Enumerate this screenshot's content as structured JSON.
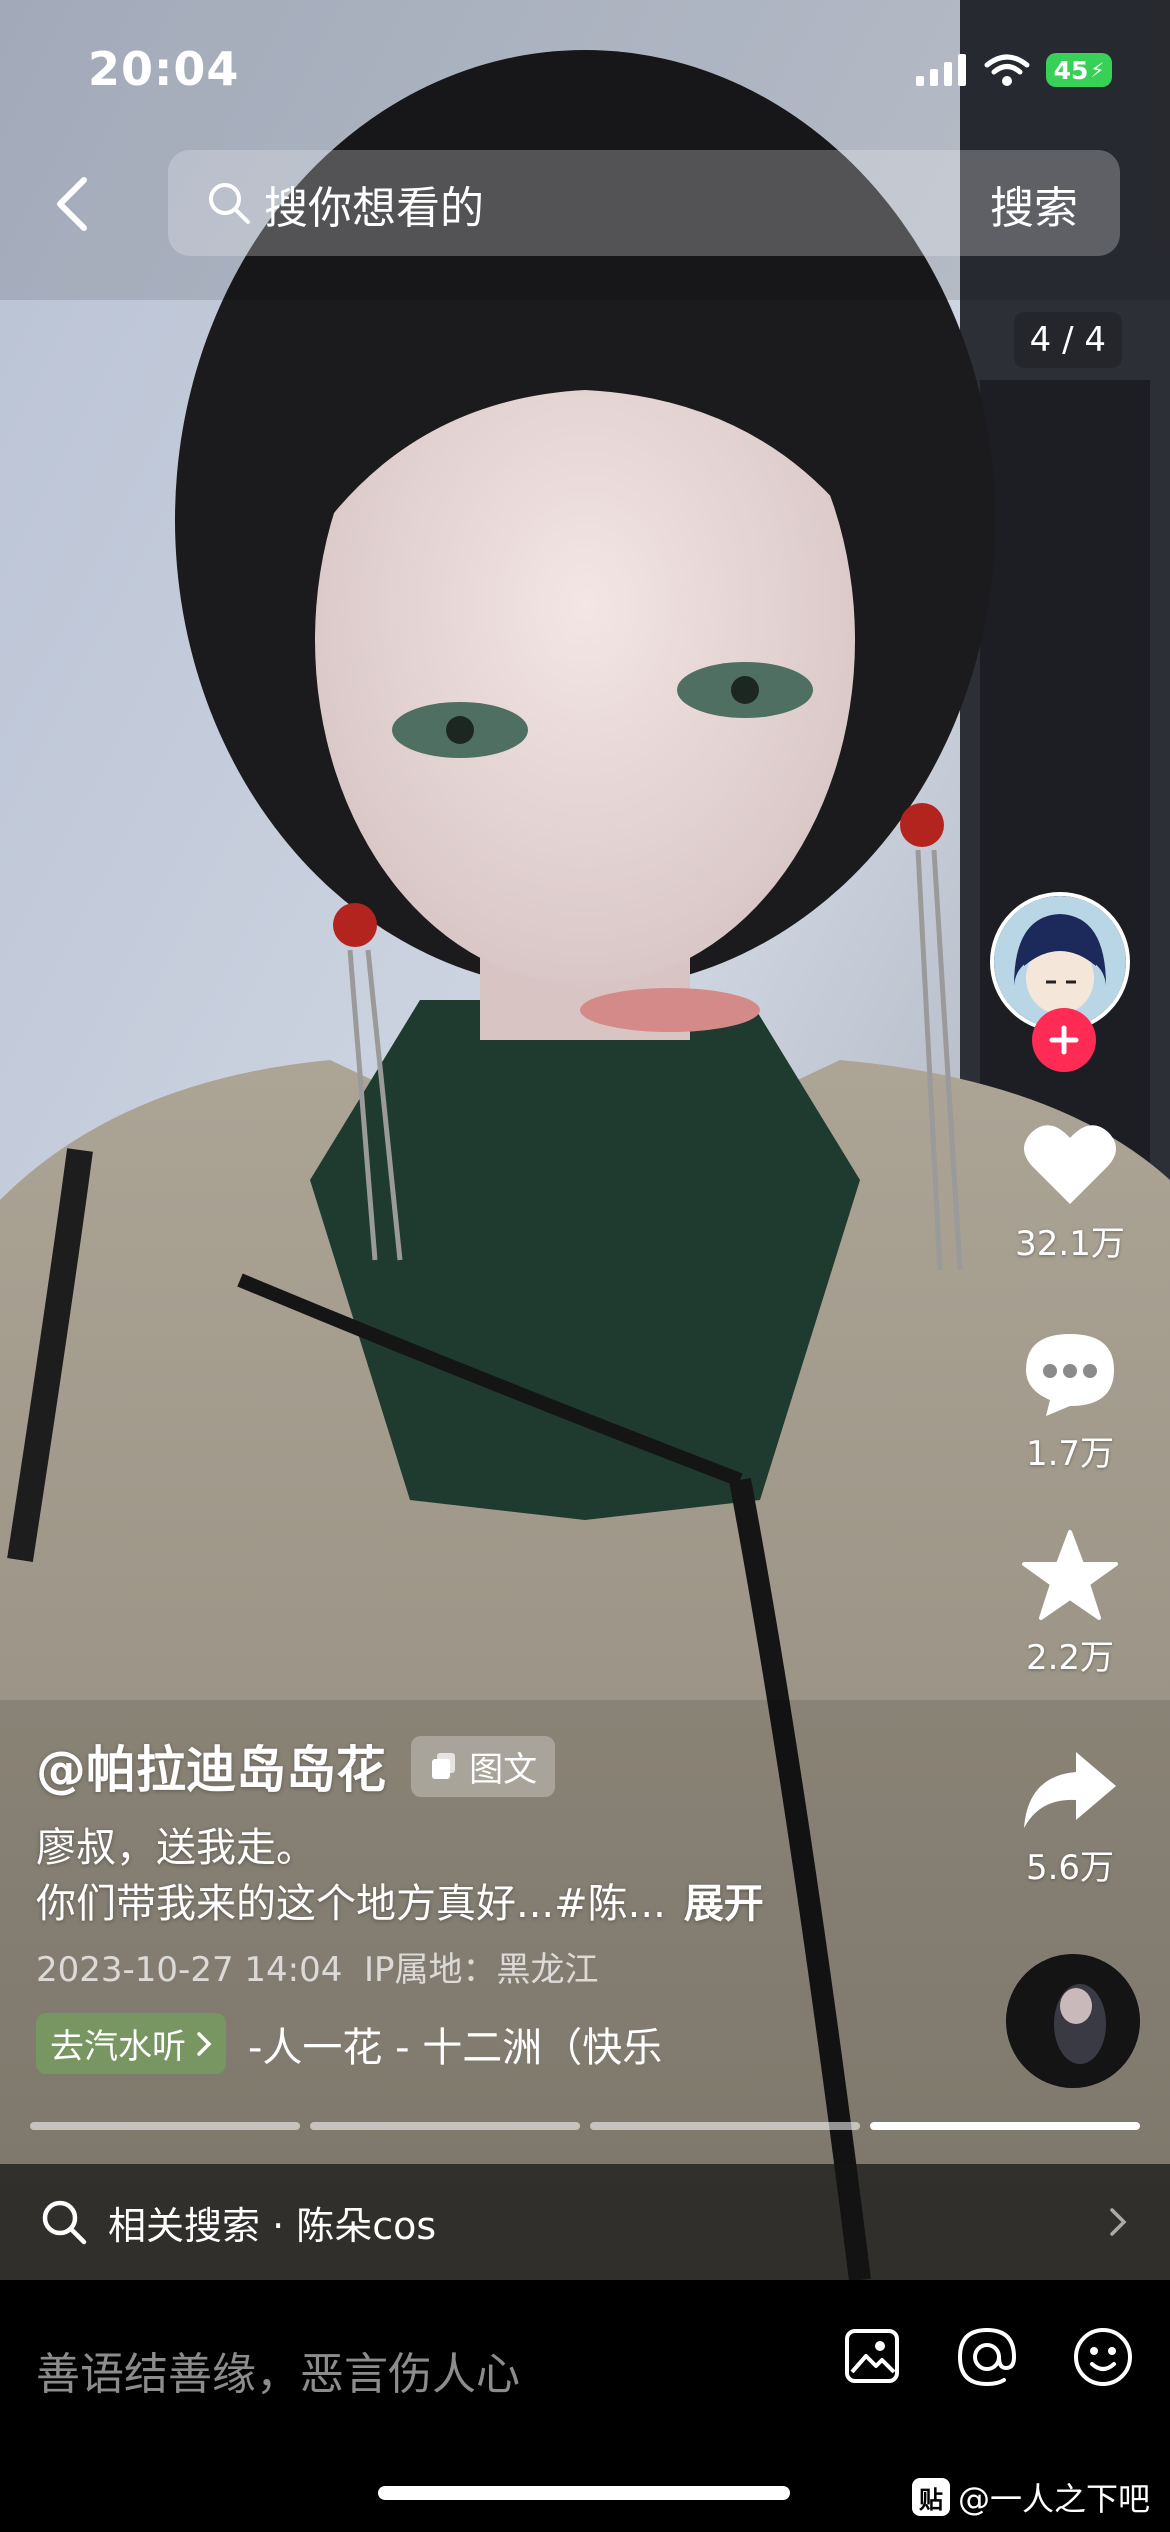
{
  "status_bar": {
    "time": "20:04",
    "battery": "45"
  },
  "search": {
    "placeholder": "搜你想看的",
    "button": "搜索"
  },
  "page_indicator": "4 / 4",
  "actions": {
    "likes": "32.1万",
    "comments": "1.7万",
    "favorites": "2.2万",
    "shares": "5.6万"
  },
  "post": {
    "author": "@帕拉迪岛岛花",
    "type_badge": "图文",
    "line1": "廖叔，送我走。",
    "line2": "你们带我来的这个地方真好...#陈...",
    "expand": "展开",
    "date": "2023-10-27 14:04",
    "ip": "IP属地：黑龙江",
    "music_tag": "去汽水听",
    "music_title": "-人一花 - 十二洲（快乐"
  },
  "related": {
    "label": "相关搜索 · 陈朵cos"
  },
  "comment_input": {
    "placeholder": "善语结善缘，恶言伤人心"
  },
  "watermark": {
    "icon": "贴",
    "text": "@一人之下吧"
  },
  "colors": {
    "accent": "#fe2c55",
    "music_tag": "#73a55a",
    "battery": "#38d158"
  }
}
